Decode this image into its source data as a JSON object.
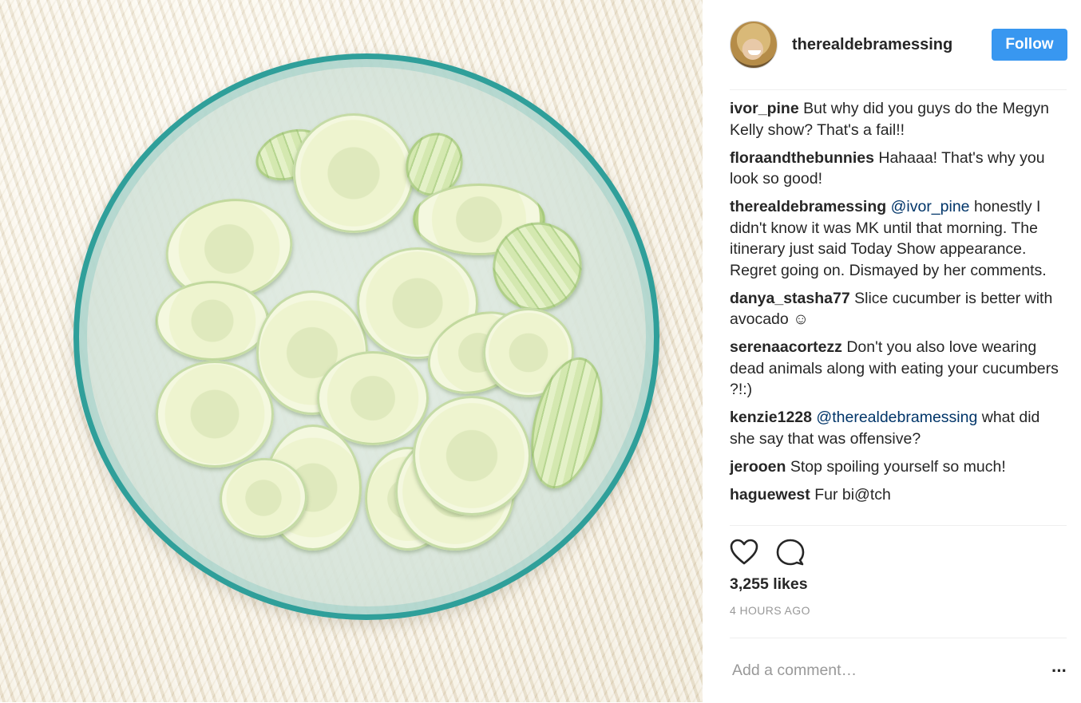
{
  "post": {
    "username": "therealdebramessing",
    "follow_label": "Follow",
    "likes": "3,255 likes",
    "time": "4 HOURS AGO",
    "add_comment_placeholder": "Add a comment…",
    "more_label": "···"
  },
  "comments": [
    {
      "user": "ivor_pine",
      "mention": "",
      "text": "But why did you guys do the Megyn Kelly show? That's a fail!!"
    },
    {
      "user": "floraandthebunnies",
      "mention": "",
      "text": "Hahaaa! That's why you look so good!"
    },
    {
      "user": "therealdebramessing",
      "mention": "@ivor_pine",
      "text": "honestly I didn't know it was MK until that morning. The itinerary just said Today Show appearance. Regret going on. Dismayed by her comments."
    },
    {
      "user": "danya_stasha77",
      "mention": "",
      "text": "Slice cucumber is better with avocado ☺"
    },
    {
      "user": "serenaacortezz",
      "mention": "",
      "text": "Don't you also love wearing dead animals along with eating your cucumbers ?!:)"
    },
    {
      "user": "kenzie1228",
      "mention": "@therealdebramessing",
      "text": "what did she say that was offensive?"
    },
    {
      "user": "jerooen",
      "mention": "",
      "text": "Stop spoiling yourself so much!"
    },
    {
      "user": "haguewest",
      "mention": "",
      "text": "Fur bi@tch"
    }
  ],
  "icons": {
    "like": "heart-icon",
    "comment": "comment-bubble-icon",
    "more": "more-options-icon"
  },
  "colors": {
    "follow_button": "#3897f0",
    "mention": "#003569",
    "bowl_rim": "#2f9f9a"
  }
}
